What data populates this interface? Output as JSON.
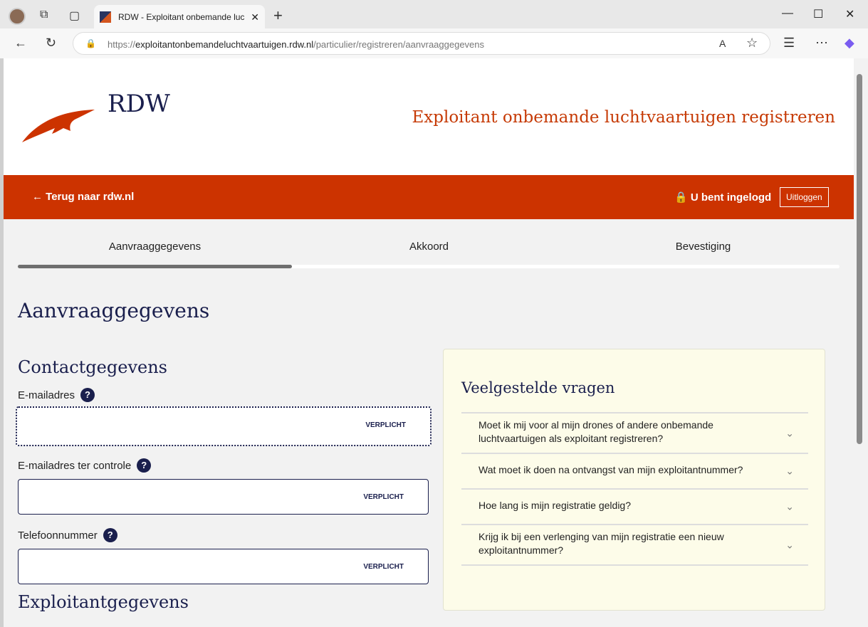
{
  "browser": {
    "tab_title": "RDW - Exploitant onbemande luc",
    "url_prefix": "https://",
    "url_domain": "exploitantonbemandeluchtvaartuigen.rdw.nl",
    "url_path": "/particulier/registreren/aanvraaggegevens"
  },
  "header": {
    "logo": "RDW",
    "title": "Exploitant onbemande luchtvaartuigen registreren"
  },
  "bar": {
    "back": "← Terug naar rdw.nl",
    "logged_in": "U bent ingelogd",
    "logout": "Uitloggen"
  },
  "steps": [
    {
      "label": "Aanvraaggegevens"
    },
    {
      "label": "Akkoord"
    },
    {
      "label": "Bevestiging"
    }
  ],
  "progress_step": 1,
  "main": {
    "title": "Aanvraaggegevens",
    "section1": "Contactgegevens",
    "section2": "Exploitantgegevens",
    "fields": [
      {
        "label": "E-mailadres",
        "required": "VERPLICHT",
        "value": ""
      },
      {
        "label": "E-mailadres ter controle",
        "required": "VERPLICHT",
        "value": ""
      },
      {
        "label": "Telefoonnummer",
        "required": "VERPLICHT",
        "value": ""
      }
    ],
    "help": "?"
  },
  "faq": {
    "title": "Veelgestelde vragen",
    "items": [
      "Moet ik mij voor al mijn drones of andere onbemande luchtvaartuigen als exploitant registreren?",
      "Wat moet ik doen na ontvangst van mijn exploitantnummer?",
      "Hoe lang is mijn registratie geldig?",
      "Krijg ik bij een verlenging van mijn registratie een nieuw exploitantnummer?"
    ]
  }
}
